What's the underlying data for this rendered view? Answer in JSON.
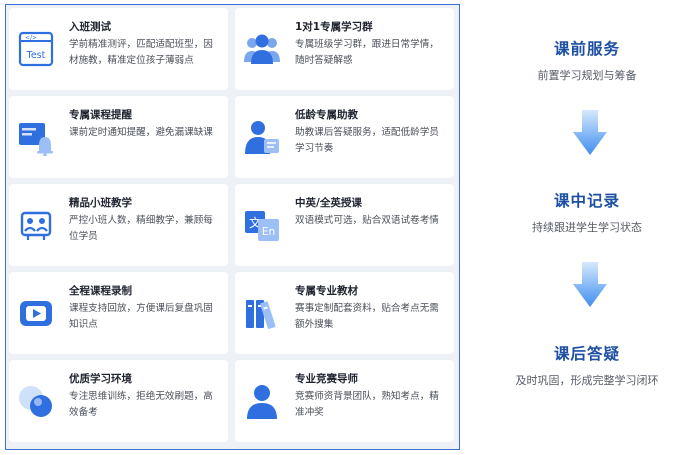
{
  "features": [
    {
      "title": "入班测试",
      "desc": "学前精准测评，匹配适配班型，因材施教，精准定位孩子薄弱点",
      "icon": "test-icon",
      "icon_text": "Test"
    },
    {
      "title": "1对1专属学习群",
      "desc": "专属班级学习群，跟进日常学情，随时答疑解惑",
      "icon": "group-icon"
    },
    {
      "title": "专属课程提醒",
      "desc": "课前定时通知提醒，避免漏课缺课",
      "icon": "bell-icon"
    },
    {
      "title": "低龄专属助教",
      "desc": "助教课后答疑服务，适配低龄学员学习节奏",
      "icon": "assistant-icon"
    },
    {
      "title": "精品小班教学",
      "desc": "严控小班人数，精细教学，兼顾每位学员",
      "icon": "class-icon"
    },
    {
      "title": "中英/全英授课",
      "desc": "双语模式可选，贴合双语试卷考情",
      "icon": "translate-icon",
      "icon_text_a": "文",
      "icon_text_b": "En"
    },
    {
      "title": "全程课程录制",
      "desc": "课程支持回放，方便课后复盘巩固知识点",
      "icon": "video-icon"
    },
    {
      "title": "专属专业教材",
      "desc": "赛事定制配套资料，贴合考点无需额外搜集",
      "icon": "books-icon"
    },
    {
      "title": "优质学习环境",
      "desc": "专注思维训练，拒绝无效刷题，高效备考",
      "icon": "environment-icon"
    },
    {
      "title": "专业竞赛导师",
      "desc": "竞赛师资背景团队，熟知考点，精准冲奖",
      "icon": "mentor-icon"
    }
  ],
  "stages": [
    {
      "title": "课前服务",
      "desc": "前置学习规划与筹备"
    },
    {
      "title": "课中记录",
      "desc": "持续跟进学生学习状态"
    },
    {
      "title": "课后答疑",
      "desc": "及时巩固，形成完整学习闭环"
    }
  ],
  "colors": {
    "accent": "#2f6fe0",
    "title": "#1d4fa3",
    "border": "#3a6fd8"
  }
}
